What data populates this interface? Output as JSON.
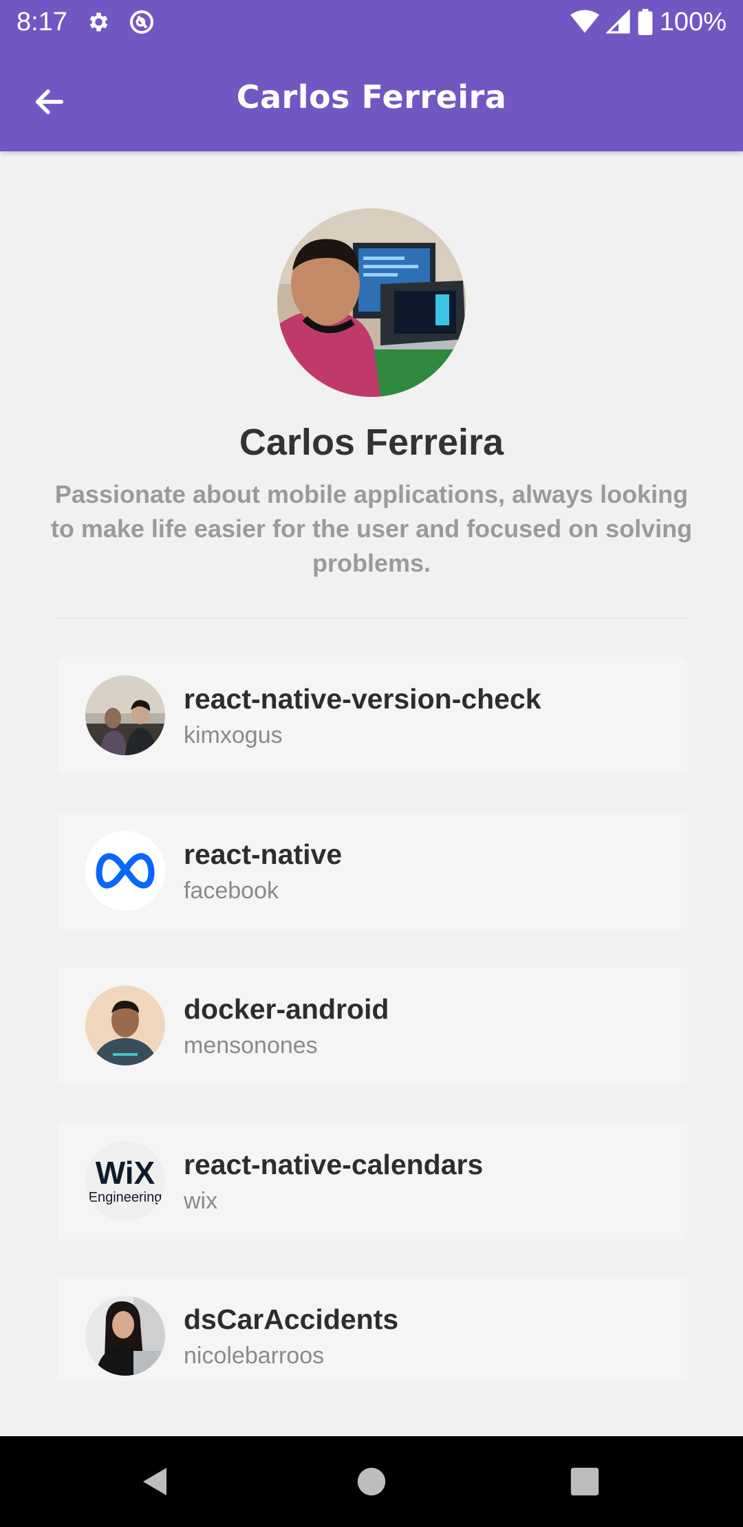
{
  "status_bar": {
    "time": "8:17",
    "battery": "100%",
    "icons": [
      "settings-icon",
      "vpn-icon",
      "wifi-icon",
      "signal-icon",
      "battery-icon"
    ]
  },
  "app_bar": {
    "title": "Carlos Ferreira",
    "back_icon": "arrow-back-icon",
    "color": "#7257c3"
  },
  "profile": {
    "name": "Carlos Ferreira",
    "bio": "Passionate about mobile applications, always looking to make life easier for the user and focused on solving problems."
  },
  "repos": [
    {
      "name": "react-native-version-check",
      "owner": "kimxogus"
    },
    {
      "name": "react-native",
      "owner": "facebook"
    },
    {
      "name": "docker-android",
      "owner": "mensonones"
    },
    {
      "name": "react-native-calendars",
      "owner": "wix"
    },
    {
      "name": "dsCarAccidents",
      "owner": "nicolebarroos"
    }
  ],
  "wix_logo": {
    "word": "WiX",
    "sub": "Engineering"
  },
  "nav_bar": {
    "buttons": [
      "back-nav-icon",
      "home-nav-icon",
      "recents-nav-icon"
    ]
  }
}
